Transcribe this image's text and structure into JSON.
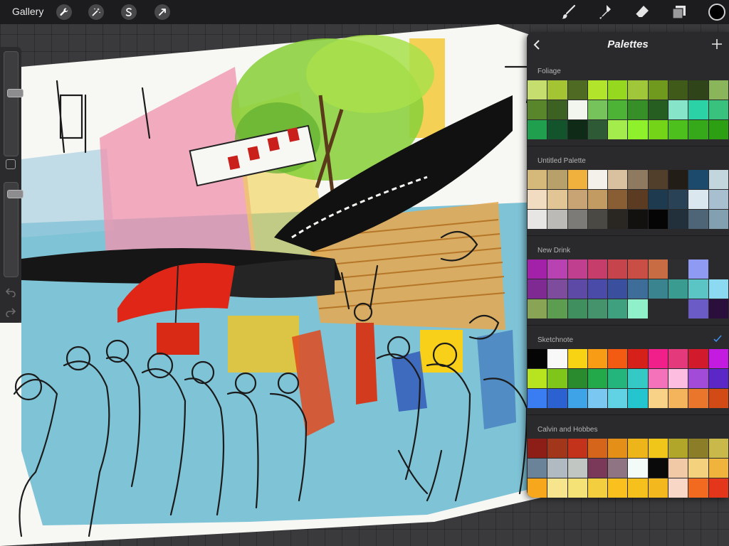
{
  "toolbar": {
    "gallery_label": "Gallery",
    "left_tools": [
      "wrench-icon",
      "magic-wand-icon",
      "selection-icon",
      "transform-arrow-icon"
    ],
    "right_tools": [
      "brush-icon",
      "smudge-icon",
      "eraser-icon",
      "layers-icon"
    ],
    "current_color": "#000000"
  },
  "sidebar": {
    "brush_size_level": 0.62,
    "opacity_level": 0.08,
    "icons": [
      "modify-button",
      "undo-icon",
      "redo-icon"
    ]
  },
  "palettes": {
    "title": "Palettes",
    "sections": [
      {
        "name": "Foliage",
        "active": false,
        "colors": [
          "#c6de6e",
          "#a4c433",
          "#4f6a22",
          "#b3e42c",
          "#96d81f",
          "#a0c63a",
          "#6f9a1d",
          "#3f5a19",
          "#2f4419",
          "#8ab55a",
          "#59862b",
          "#3c6122",
          "#f3f6ee",
          "#77c35b",
          "#4db336",
          "#378f28",
          "#265e22",
          "#86e5c8",
          "#2bd2a6",
          "#38c27d",
          "#20a04f",
          "#13542c",
          "#0f2a17",
          "#2e5b35",
          "#a4ec4c",
          "#8ff12c",
          "#74d418",
          "#4ec01d",
          "#35a91a",
          "#2c9f13"
        ]
      },
      {
        "name": "Untitled Palette",
        "active": false,
        "colors": [
          "#d5b97a",
          "#b8a06a",
          "#f1b23d",
          "#f4f1ea",
          "#d9c1a0",
          "#8e7a60",
          "#523f2b",
          "#231d18",
          "#1c4a6c",
          "#c3d6de",
          "#f1dcc2",
          "#e1c595",
          "#c8a474",
          "#c29b63",
          "#8a5e34",
          "#5b3c22",
          "#1d3a4e",
          "#2a4255",
          "#dbe7ee",
          "#a7bfcf",
          "#e7e6e4",
          "#bcbab6",
          "#7d7b78",
          "#4b4944",
          "#2a2723",
          "#131110",
          "#050505",
          "#21303a",
          "#4d6576",
          "#83a0b0"
        ]
      },
      {
        "name": "New Drink",
        "active": false,
        "colors": [
          "#a221a8",
          "#b942b3",
          "#c13f8f",
          "#c63d6c",
          "#c6454c",
          "#c94e45",
          "#c76c43",
          "#2e2e30",
          "#8f9bf2",
          "#2a2a2c",
          "#7e2a92",
          "#7d4c9c",
          "#5d4aa6",
          "#4a4aa8",
          "#3b4f9f",
          "#3f6d99",
          "#39848f",
          "#3a9b91",
          "#5bc4c4",
          "#8cd9f2",
          "#89a455",
          "#5d9d52",
          "#3f8f5f",
          "#44936c",
          "#3ea07f",
          "#8ff0c9",
          "#2a2a2c",
          "#2a2a2c",
          "#6b5bc6",
          "#2a0f3c"
        ]
      },
      {
        "name": "Sketchnote",
        "active": true,
        "colors": [
          "#050505",
          "#f8f8f8",
          "#f8d313",
          "#f79c14",
          "#f35a12",
          "#d5211a",
          "#f11f8a",
          "#e43a7b",
          "#d11a2b",
          "#c31be0",
          "#b7e41f",
          "#80c51a",
          "#2a8a2e",
          "#23a84a",
          "#24b57c",
          "#34c9c4",
          "#f472ba",
          "#fcbde0",
          "#a14bd8",
          "#5b27c6",
          "#3a7df2",
          "#2b61d0",
          "#3fa3e8",
          "#7ac8f2",
          "#61d2e4",
          "#25c5cf",
          "#f7d287",
          "#f4b45c",
          "#e9762b",
          "#d24a15"
        ]
      },
      {
        "name": "Calvin and Hobbes",
        "active": false,
        "colors": [
          "#8c1d17",
          "#a2361b",
          "#c3331c",
          "#d5651b",
          "#e48f17",
          "#eeb51a",
          "#f0c61a",
          "#b1a52a",
          "#8c7d28",
          "#c9b84a",
          "#6b8398",
          "#b0bac0",
          "#c2c6c3",
          "#7a3958",
          "#8f7584",
          "#f2fbf7",
          "#0a0a0a",
          "#f1c9a7",
          "#f4d17c",
          "#f0b43c",
          "#f6a71c",
          "#f7e58e",
          "#f4e277",
          "#f3ce3e",
          "#fac01d",
          "#f6c11d",
          "#f3b81e",
          "#f8d7c6",
          "#f26a1f",
          "#e4361a"
        ]
      }
    ]
  }
}
